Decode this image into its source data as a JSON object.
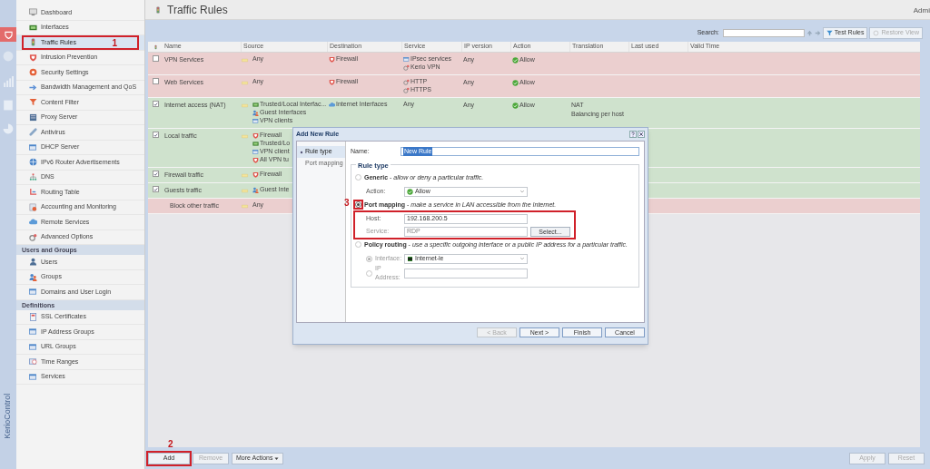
{
  "rail": {
    "brand": "KerioControl"
  },
  "sidebar": {
    "sections": [
      {
        "items": [
          {
            "label": "Dashboard",
            "selected": false
          },
          {
            "label": "Interfaces",
            "selected": false
          },
          {
            "label": "Traffic Rules",
            "selected": true,
            "annotation": "1"
          },
          {
            "label": "Intrusion Prevention",
            "selected": false
          },
          {
            "label": "Security Settings",
            "selected": false
          },
          {
            "label": "Bandwidth Management and QoS",
            "selected": false
          },
          {
            "label": "Content Filter",
            "selected": false
          },
          {
            "label": "Proxy Server",
            "selected": false
          },
          {
            "label": "Antivirus",
            "selected": false
          },
          {
            "label": "DHCP Server",
            "selected": false
          },
          {
            "label": "IPv6 Router Advertisements",
            "selected": false
          },
          {
            "label": "DNS",
            "selected": false
          },
          {
            "label": "Routing Table",
            "selected": false
          },
          {
            "label": "Accounting and Monitoring",
            "selected": false
          },
          {
            "label": "Remote Services",
            "selected": false
          },
          {
            "label": "Advanced Options",
            "selected": false
          }
        ]
      },
      {
        "title": "Users and Groups",
        "items": [
          {
            "label": "Users",
            "selected": false
          },
          {
            "label": "Groups",
            "selected": false
          },
          {
            "label": "Domains and User Login",
            "selected": false
          }
        ]
      },
      {
        "title": "Definitions",
        "items": [
          {
            "label": "SSL Certificates",
            "selected": false
          },
          {
            "label": "IP Address Groups",
            "selected": false
          },
          {
            "label": "URL Groups",
            "selected": false
          },
          {
            "label": "Time Ranges",
            "selected": false
          },
          {
            "label": "Services",
            "selected": false
          }
        ]
      }
    ]
  },
  "header": {
    "title": "Traffic Rules",
    "user": "Admi"
  },
  "toolbar": {
    "search_label": "Search:",
    "buttons": [
      {
        "label": "Test Rules",
        "disabled": false
      },
      {
        "label": "Restore View",
        "disabled": true
      }
    ]
  },
  "table": {
    "columns": [
      "Name",
      "Source",
      "Destination",
      "Service",
      "IP version",
      "Action",
      "Translation",
      "Last used",
      "Valid Time"
    ],
    "rows": [
      {
        "kind": "rule",
        "checked": false,
        "color": "#ebcfcf",
        "name": "VPN Services",
        "source": [
          {
            "kind": "text",
            "text": "Any"
          }
        ],
        "destination": [
          {
            "kind": "firewall",
            "text": "Firewall"
          }
        ],
        "service": [
          {
            "kind": "vpn",
            "text": "IPsec services"
          },
          {
            "kind": "service",
            "text": "Kerio VPN"
          }
        ],
        "ip_version": "Any",
        "action": "Allow",
        "translation": []
      },
      {
        "kind": "rule",
        "checked": false,
        "color": "#ebcfcf",
        "name": "Web Services",
        "source": [
          {
            "kind": "text",
            "text": "Any"
          }
        ],
        "destination": [
          {
            "kind": "firewall",
            "text": "Firewall"
          }
        ],
        "service": [
          {
            "kind": "service",
            "text": "HTTP"
          },
          {
            "kind": "service",
            "text": "HTTPS"
          }
        ],
        "ip_version": "Any",
        "action": "Allow",
        "translation": []
      },
      {
        "kind": "rule",
        "checked": true,
        "color": "#cfe2cd",
        "name": "Internet access (NAT)",
        "source": [
          {
            "kind": "interface",
            "text": "Trusted/Local Interfac..."
          },
          {
            "kind": "users",
            "text": "Guest Interfaces"
          },
          {
            "kind": "vpn",
            "text": "VPN clients"
          }
        ],
        "destination": [
          {
            "kind": "cloud",
            "text": "Internet Interfaces"
          }
        ],
        "service": [
          {
            "kind": "text",
            "text": "Any"
          }
        ],
        "ip_version": "Any",
        "action": "Allow",
        "translation": [
          "NAT",
          "Balancing per host"
        ]
      },
      {
        "kind": "rule",
        "checked": true,
        "color": "#cfe2cd",
        "name": "Local traffic",
        "source": [
          {
            "kind": "firewall",
            "text": "Firewall"
          },
          {
            "kind": "interface",
            "text": "Trusted/Lo"
          },
          {
            "kind": "vpn",
            "text": "VPN client"
          },
          {
            "kind": "firewall",
            "text": "All VPN tu"
          }
        ],
        "destination": [],
        "service": [],
        "translation": []
      },
      {
        "kind": "rule",
        "checked": true,
        "color": "#cfe2cd",
        "name": "Firewall traffic",
        "source": [
          {
            "kind": "firewall",
            "text": "Firewall"
          }
        ],
        "destination": [],
        "service": [],
        "translation": []
      },
      {
        "kind": "rule",
        "checked": true,
        "color": "#cfe2cd",
        "name": "Guests traffic",
        "source": [
          {
            "kind": "users",
            "text": "Guest Inte"
          }
        ],
        "destination": [],
        "service": [],
        "translation": []
      },
      {
        "kind": "default",
        "color": "#ebcfcf",
        "name": "Block other traffic",
        "source": [
          {
            "kind": "text",
            "text": "Any"
          }
        ],
        "destination": [],
        "service": [],
        "translation": []
      }
    ]
  },
  "bottom_bar": {
    "left": [
      {
        "label": "Add",
        "disabled": false,
        "annotation": "2"
      },
      {
        "label": "Remove",
        "disabled": true
      },
      {
        "label": "More Actions",
        "disabled": false
      }
    ],
    "right": [
      {
        "label": "Apply",
        "disabled": true
      },
      {
        "label": "Reset",
        "disabled": true
      }
    ]
  },
  "dialog": {
    "title": "Add New Rule",
    "nav": [
      {
        "label": "Rule type",
        "selected": true
      },
      {
        "label": "Port mapping",
        "selected": false
      }
    ],
    "name_label": "Name:",
    "name_value": "New Rule",
    "group_title": "Rule type",
    "options": [
      {
        "kind": "generic",
        "selected": false,
        "text": "**Generic** - *allow or deny a particular traffic.*",
        "action_label": "Action:",
        "action_value": "Allow"
      },
      {
        "kind": "port_mapping",
        "selected": true,
        "annotation": "3",
        "text": "**Port mapping** - *make a service in LAN accessible from the Internet.*",
        "host_label": "Host:",
        "host_value": "192.168.200.5",
        "service_label": "Service:",
        "service_value": "RDP",
        "select_button": "Select..."
      },
      {
        "kind": "policy_routing",
        "selected": false,
        "text": "**Policy routing** - *use a specific outgoing interface or a public IP address for a particular traffic.*",
        "choices": [
          {
            "label": "Interface:",
            "selected": true,
            "value": "Internet-le"
          },
          {
            "label": "IP Address:",
            "selected": false
          }
        ]
      }
    ],
    "buttons": [
      {
        "label": "< Back",
        "disabled": true
      },
      {
        "label": "Next >",
        "disabled": false
      },
      {
        "label": "Finish",
        "disabled": false
      },
      {
        "label": "Cancel",
        "disabled": false
      }
    ]
  }
}
